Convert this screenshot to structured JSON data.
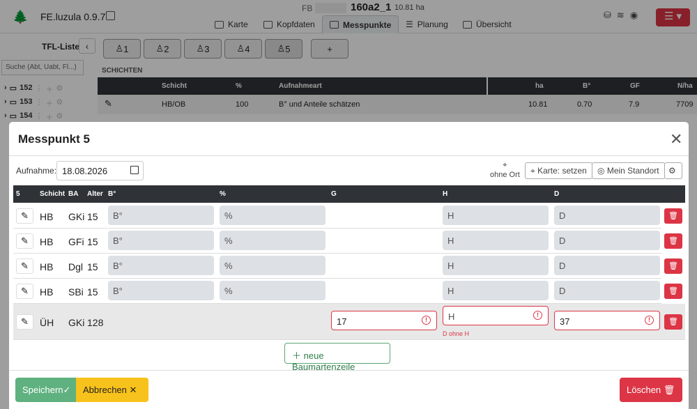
{
  "app": {
    "name": "FE.luzula 0.9.7"
  },
  "header": {
    "fb_label": "FB",
    "code": "160a2_1",
    "area": "10.81 ha"
  },
  "tabs": [
    {
      "label": "Karte"
    },
    {
      "label": "Kopfdaten"
    },
    {
      "label": "Messpunkte",
      "active": true
    },
    {
      "label": "Planung"
    },
    {
      "label": "Übersicht"
    }
  ],
  "sidebar": {
    "title": "TFL-Liste",
    "search_placeholder": "Suche (Abt, Uabt, Fl...)",
    "items": [
      {
        "label": "152"
      },
      {
        "label": "153"
      },
      {
        "label": "154"
      }
    ]
  },
  "messpunkte": {
    "buttons": [
      "1",
      "2",
      "3",
      "4",
      "5"
    ],
    "add_label": "+"
  },
  "schichten": {
    "title": "SCHICHTEN",
    "headers": [
      "Schicht",
      "%",
      "Aufnahmeart",
      "ha",
      "B°",
      "GF",
      "N/ha"
    ],
    "rows": [
      {
        "schicht": "HB/OB",
        "pct": "100",
        "art": "B° und Anteile schätzen",
        "ha": "10.81",
        "b": "0.70",
        "gf": "7.9",
        "nha": "7709"
      }
    ]
  },
  "modal": {
    "title": "Messpunkt 5",
    "aufnahme_label": "Aufnahme:",
    "aufnahme_value": "18.08.2026",
    "ort_label": "ohne Ort",
    "karte_btn": "Karte: setzen",
    "standort_btn": "Mein Standort",
    "table": {
      "headers": [
        "5",
        "Schicht",
        "BA",
        "Alter",
        "B°",
        "%",
        "G",
        "H",
        "D"
      ],
      "rows": [
        {
          "schicht": "HB",
          "ba": "GKi",
          "alter": "15",
          "b_ph": "B°",
          "pct_ph": "%",
          "h_ph": "H",
          "d_ph": "D"
        },
        {
          "schicht": "HB",
          "ba": "GFi",
          "alter": "15",
          "b_ph": "B°",
          "pct_ph": "%",
          "h_ph": "H",
          "d_ph": "D"
        },
        {
          "schicht": "HB",
          "ba": "Dgl",
          "alter": "15",
          "b_ph": "B°",
          "pct_ph": "%",
          "h_ph": "H",
          "d_ph": "D"
        },
        {
          "schicht": "HB",
          "ba": "SBi",
          "alter": "15",
          "b_ph": "B°",
          "pct_ph": "%",
          "h_ph": "H",
          "d_ph": "D"
        },
        {
          "schicht": "ÜH",
          "ba": "GKi",
          "alter": "128",
          "g_value": "17",
          "h_ph": "H",
          "d_value": "37",
          "h_error": "D ohne H"
        }
      ]
    },
    "new_row_btn": "neue Baumartenzeile",
    "save_btn": "Speichern",
    "cancel_btn": "Abbrechen",
    "delete_btn": "Löschen"
  },
  "colors": {
    "danger": "#dc3545",
    "success": "#5fb17f",
    "warning": "#f8c21c",
    "header_dark": "#2f3337"
  }
}
